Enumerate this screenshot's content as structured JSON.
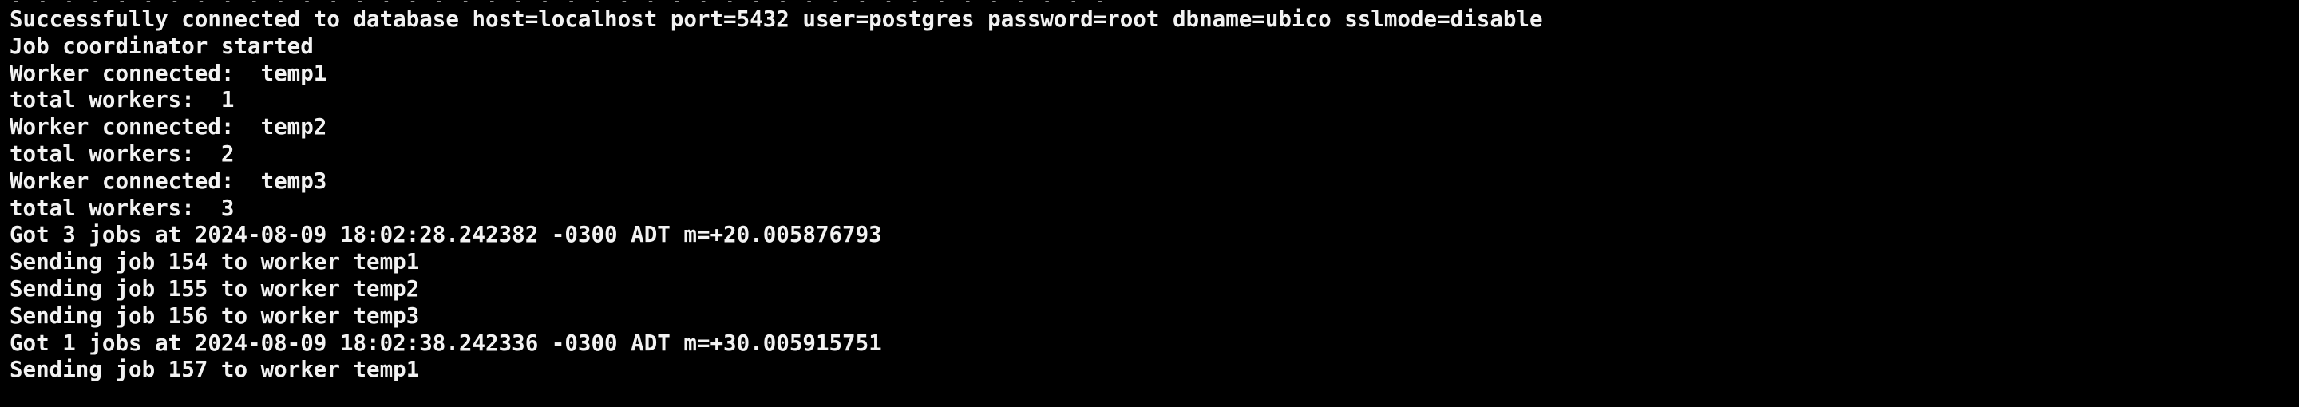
{
  "terminal": {
    "partial_top_line": ". . . . . . . . . . . . . . . . . . . . . . . . . . . . . . . . . . . . . . . . . .",
    "lines": [
      "Successfully connected to database host=localhost port=5432 user=postgres password=root dbname=ubico sslmode=disable",
      "Job coordinator started",
      "Worker connected:  temp1",
      "total workers:  1",
      "Worker connected:  temp2",
      "total workers:  2",
      "Worker connected:  temp3",
      "total workers:  3",
      "Got 3 jobs at 2024-08-09 18:02:28.242382 -0300 ADT m=+20.005876793",
      "Sending job 154 to worker temp1",
      "Sending job 155 to worker temp2",
      "Sending job 156 to worker temp3",
      "Got 1 jobs at 2024-08-09 18:02:38.242336 -0300 ADT m=+30.005915751",
      "Sending job 157 to worker temp1"
    ],
    "colors": {
      "background": "#000000",
      "text": "#f2f2f2"
    }
  }
}
